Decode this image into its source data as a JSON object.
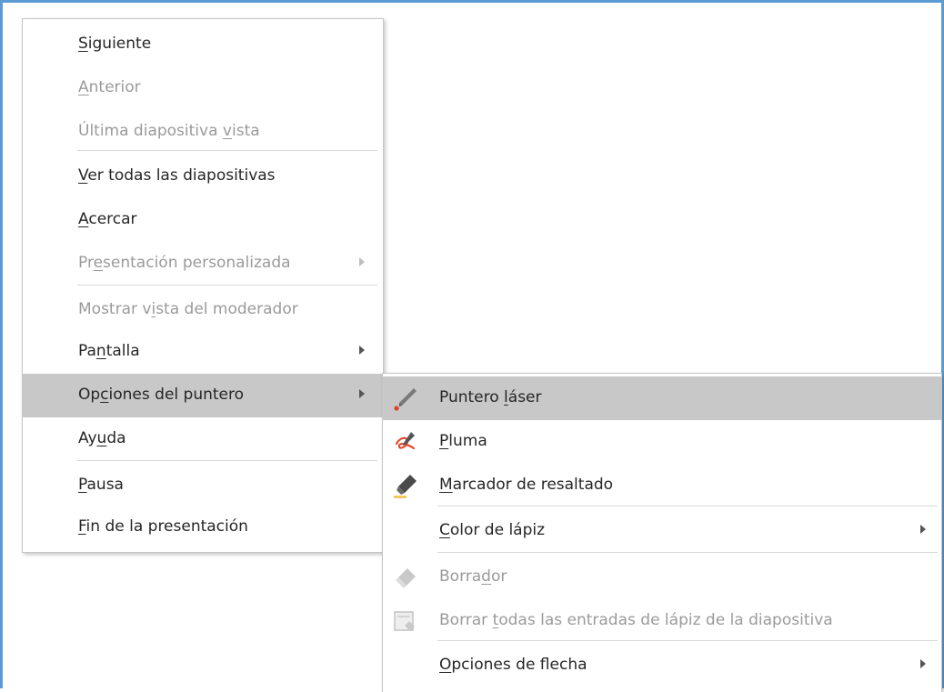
{
  "main_menu": {
    "items": [
      {
        "pre": "",
        "u": "S",
        "post": "iguiente",
        "disabled": false,
        "submenu": false
      },
      {
        "pre": "",
        "u": "A",
        "post": "nterior",
        "disabled": true,
        "submenu": false
      },
      {
        "pre": "Última diapositiva ",
        "u": "v",
        "post": "ista",
        "disabled": true,
        "submenu": false
      },
      {
        "pre": "",
        "u": "V",
        "post": "er todas las diapositivas",
        "disabled": false,
        "submenu": false
      },
      {
        "pre": "",
        "u": "A",
        "post": "cercar",
        "disabled": false,
        "submenu": false
      },
      {
        "pre": "Pr",
        "u": "e",
        "post": "sentación personalizada",
        "disabled": true,
        "submenu": true
      },
      {
        "pre": "Mostrar v",
        "u": "i",
        "post": "sta del moderador",
        "disabled": true,
        "submenu": false
      },
      {
        "pre": "Pa",
        "u": "n",
        "post": "talla",
        "disabled": false,
        "submenu": true
      },
      {
        "pre": "Op",
        "u": "c",
        "post": "iones del puntero",
        "disabled": false,
        "submenu": true
      },
      {
        "pre": "Ay",
        "u": "u",
        "post": "da",
        "disabled": false,
        "submenu": false
      },
      {
        "pre": "",
        "u": "P",
        "post": "ausa",
        "disabled": false,
        "submenu": false
      },
      {
        "pre": "",
        "u": "F",
        "post": "in de la presentación",
        "disabled": false,
        "submenu": false
      }
    ]
  },
  "pointer_submenu": {
    "items": [
      {
        "pre": "Puntero ",
        "u": "l",
        "post": "áser",
        "disabled": false,
        "submenu": false,
        "icon": "laser-pointer-icon"
      },
      {
        "pre": "",
        "u": "P",
        "post": "luma",
        "disabled": false,
        "submenu": false,
        "icon": "pen-icon"
      },
      {
        "pre": "",
        "u": "M",
        "post": "arcador de resaltado",
        "disabled": false,
        "submenu": false,
        "icon": "highlighter-icon"
      },
      {
        "pre": "",
        "u": "C",
        "post": "olor de lápiz",
        "disabled": false,
        "submenu": true,
        "icon": ""
      },
      {
        "pre": "Borra",
        "u": "d",
        "post": "or",
        "disabled": true,
        "submenu": false,
        "icon": "eraser-icon"
      },
      {
        "pre": "Borrar ",
        "u": "t",
        "post": "odas las entradas de lápiz de la diapositiva",
        "disabled": true,
        "submenu": false,
        "icon": "erase-all-ink-icon"
      },
      {
        "pre": "",
        "u": "O",
        "post": "pciones de flecha",
        "disabled": false,
        "submenu": true,
        "icon": ""
      }
    ]
  },
  "colors": {
    "highlight": "#c8c8c8",
    "frame_border": "#5b9bd5",
    "text": "#262626",
    "disabled_text": "#9a9a9a"
  }
}
